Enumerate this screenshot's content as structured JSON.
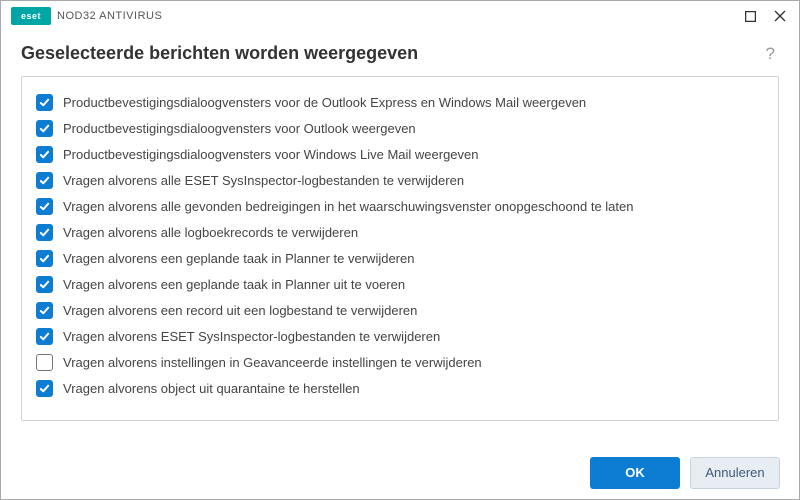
{
  "brand": {
    "badge": "eset",
    "product": "NOD32 ANTIVIRUS"
  },
  "header": {
    "title": "Geselecteerde berichten worden weergegeven"
  },
  "help": {
    "symbol": "?"
  },
  "messages": [
    {
      "checked": true,
      "label": "Productbevestigingsdialoogvensters voor de Outlook Express en Windows Mail weergeven"
    },
    {
      "checked": true,
      "label": "Productbevestigingsdialoogvensters voor Outlook weergeven"
    },
    {
      "checked": true,
      "label": "Productbevestigingsdialoogvensters voor Windows Live Mail weergeven"
    },
    {
      "checked": true,
      "label": "Vragen alvorens alle ESET SysInspector-logbestanden te verwijderen"
    },
    {
      "checked": true,
      "label": "Vragen alvorens alle gevonden bedreigingen in het waarschuwingsvenster onopgeschoond te laten"
    },
    {
      "checked": true,
      "label": "Vragen alvorens alle logboekrecords te verwijderen"
    },
    {
      "checked": true,
      "label": "Vragen alvorens een geplande taak in Planner te verwijderen"
    },
    {
      "checked": true,
      "label": "Vragen alvorens een geplande taak in Planner uit te voeren"
    },
    {
      "checked": true,
      "label": "Vragen alvorens een record uit een logbestand te verwijderen"
    },
    {
      "checked": true,
      "label": "Vragen alvorens ESET SysInspector-logbestanden te verwijderen"
    },
    {
      "checked": false,
      "label": "Vragen alvorens instellingen in Geavanceerde instellingen te verwijderen"
    },
    {
      "checked": true,
      "label": "Vragen alvorens object uit quarantaine te herstellen"
    }
  ],
  "footer": {
    "ok": "OK",
    "cancel": "Annuleren"
  },
  "colors": {
    "accent": "#0d7dd4",
    "brand": "#00a6a6"
  }
}
